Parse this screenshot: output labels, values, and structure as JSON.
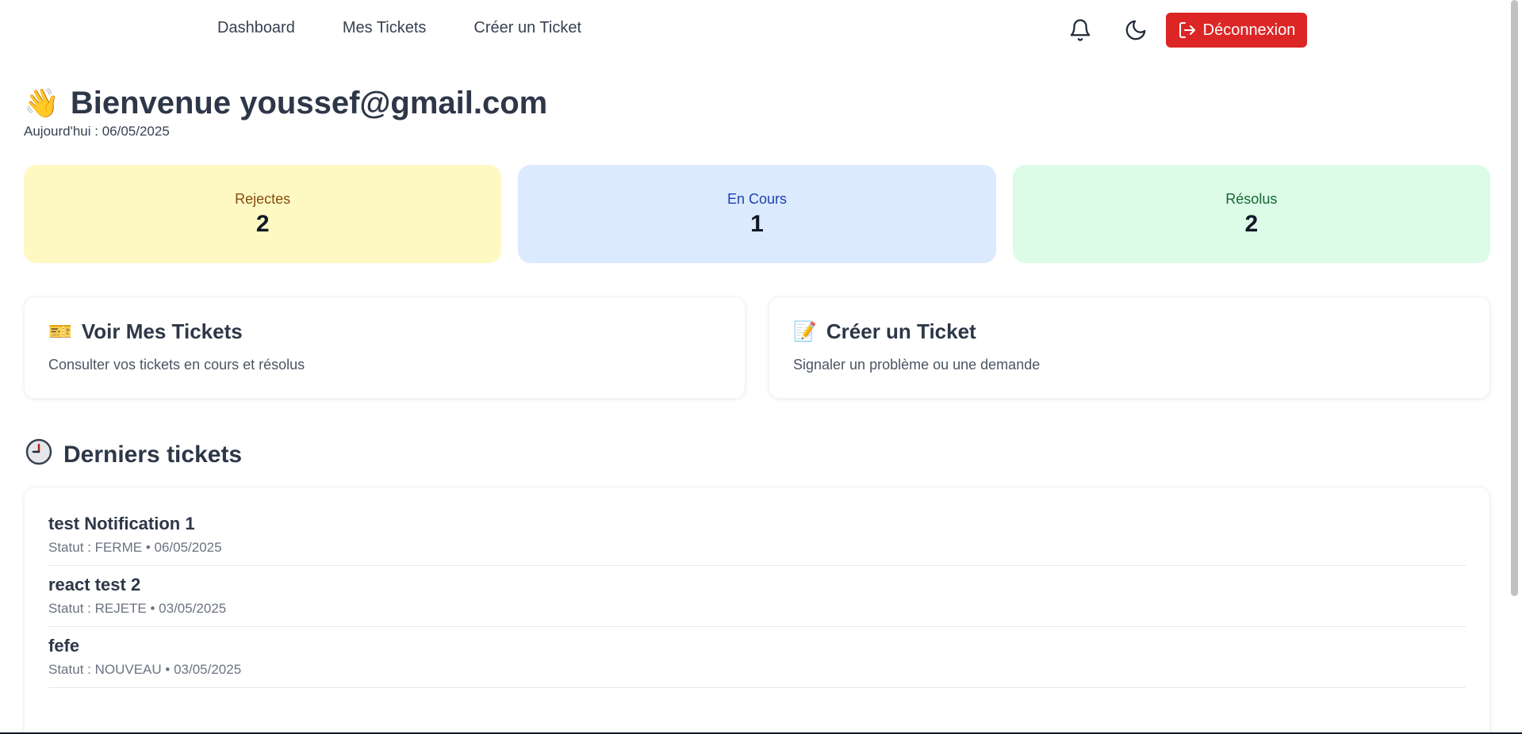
{
  "nav": {
    "links": [
      "Dashboard",
      "Mes Tickets",
      "Créer un Ticket"
    ],
    "logout_label": "Déconnexion",
    "bell_icon": "bell-icon",
    "theme_icon": "moon-icon",
    "logout_icon": "logout-icon"
  },
  "welcome": {
    "emoji": "👋",
    "title": "Bienvenue youssef@gmail.com",
    "date_line": "Aujourd'hui : 06/05/2025"
  },
  "stats": [
    {
      "label": "Rejectes",
      "value": "2",
      "color": "#fef9c3"
    },
    {
      "label": "En Cours",
      "value": "1",
      "color": "#dbeafe"
    },
    {
      "label": "Résolus",
      "value": "2",
      "color": "#dcfce7"
    }
  ],
  "actions": [
    {
      "emoji": "🎫",
      "title": "Voir Mes Tickets",
      "description": "Consulter vos tickets en cours et résolus"
    },
    {
      "emoji": "📝",
      "title": "Créer un Ticket",
      "description": "Signaler un problème ou une demande"
    }
  ],
  "recent": {
    "title": "Derniers tickets",
    "icon": "clock-icon",
    "tickets": [
      {
        "title": "test Notification 1",
        "status": "Statut : FERME",
        "date": "06/05/2025"
      },
      {
        "title": "react test 2",
        "status": "Statut : REJETE",
        "date": "03/05/2025"
      },
      {
        "title": "fefe",
        "status": "Statut : NOUVEAU",
        "date": "03/05/2025"
      }
    ]
  },
  "colors": {
    "danger": "#dc2626",
    "text_dark": "#2d3748"
  }
}
